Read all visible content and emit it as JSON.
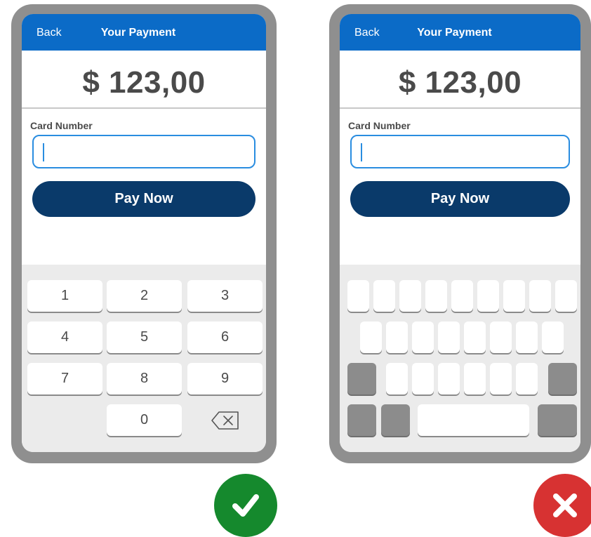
{
  "good_example": {
    "back_label": "Back",
    "title": "Your Payment",
    "amount": "$ 123,00",
    "card_label": "Card Number",
    "pay_label": "Pay Now",
    "keys": [
      "1",
      "2",
      "3",
      "4",
      "5",
      "6",
      "7",
      "8",
      "9",
      "0"
    ],
    "backspace_icon": "backspace-icon"
  },
  "bad_example": {
    "back_label": "Back",
    "title": "Your Payment",
    "amount": "$ 123,00",
    "card_label": "Card Number",
    "pay_label": "Pay Now",
    "keyboard_type": "full-alphabetic-keyboard-unlabeled"
  },
  "badges": {
    "good": "checkmark-icon",
    "bad": "cross-icon"
  },
  "colors": {
    "header": "#0b6bc7",
    "pay_button": "#0a3a6a",
    "input_border": "#2a8de0",
    "phone_frame": "#8f8f8f",
    "good": "#15892d",
    "bad": "#d73232"
  }
}
